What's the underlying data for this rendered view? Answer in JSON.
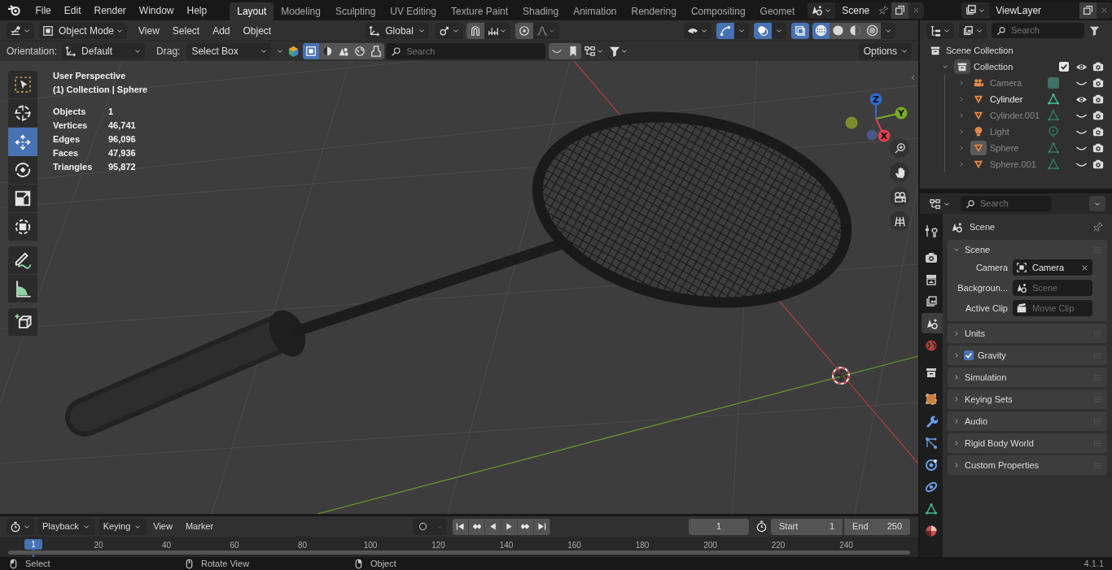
{
  "top_bar": {
    "menus": [
      "File",
      "Edit",
      "Render",
      "Window",
      "Help"
    ],
    "workspaces": [
      {
        "label": "Layout",
        "selected": true
      },
      {
        "label": "Modeling",
        "selected": false
      },
      {
        "label": "Sculpting",
        "selected": false
      },
      {
        "label": "UV Editing",
        "selected": false
      },
      {
        "label": "Texture Paint",
        "selected": false
      },
      {
        "label": "Shading",
        "selected": false
      },
      {
        "label": "Animation",
        "selected": false
      },
      {
        "label": "Rendering",
        "selected": false
      },
      {
        "label": "Compositing",
        "selected": false
      },
      {
        "label": "Geomet",
        "selected": false
      }
    ],
    "scene": "Scene",
    "view_layer": "ViewLayer"
  },
  "viewport_header": {
    "mode": "Object Mode",
    "menus": [
      "View",
      "Select",
      "Add",
      "Object"
    ],
    "transform_orientation": "Global",
    "shading": [
      {
        "kind": "wireframe",
        "selected": true
      },
      {
        "kind": "solid",
        "selected": false
      },
      {
        "kind": "material",
        "selected": false
      },
      {
        "kind": "rendered",
        "selected": false
      }
    ]
  },
  "tool_settings": {
    "orientation_label": "Orientation:",
    "orientation": "Default",
    "drag_label": "Drag:",
    "drag": "Select Box",
    "search_placeholder": "Search",
    "options": "Options"
  },
  "toolbar": [
    [
      {
        "kind": "select",
        "selected": false
      },
      {
        "kind": "cursor",
        "selected": false
      },
      {
        "kind": "move",
        "selected": true
      },
      {
        "kind": "rotate",
        "selected": false
      },
      {
        "kind": "scale",
        "selected": false
      },
      {
        "kind": "transform",
        "selected": false
      }
    ],
    [
      {
        "kind": "annotate",
        "selected": false
      },
      {
        "kind": "measure",
        "selected": false
      }
    ],
    [
      {
        "kind": "add_cube",
        "selected": false
      }
    ]
  ],
  "overlay": {
    "view": "User Perspective",
    "context": "(1) Collection | Sphere",
    "stats": [
      {
        "label": "Objects",
        "value": "1"
      },
      {
        "label": "Vertices",
        "value": "46,741"
      },
      {
        "label": "Edges",
        "value": "96,096"
      },
      {
        "label": "Faces",
        "value": "47,936"
      },
      {
        "label": "Triangles",
        "value": "95,872"
      }
    ]
  },
  "gizmo": {
    "axes": [
      {
        "kind": "z",
        "label": "Z",
        "color": "#2f6bd1"
      },
      {
        "kind": "y",
        "label": "Y",
        "color": "#7bab26"
      },
      {
        "kind": "x",
        "label": "X",
        "color": "#e0404f"
      }
    ]
  },
  "outliner": {
    "search_placeholder": "Search",
    "root": "Scene Collection",
    "collections": [
      {
        "name": "Collection",
        "expanded": true,
        "checked": true,
        "visible": true,
        "children": [
          {
            "name": "Camera",
            "kind": "camera",
            "visible": false,
            "selected": false
          },
          {
            "name": "Cylinder",
            "kind": "mesh",
            "visible": true,
            "selected": false
          },
          {
            "name": "Cylinder.001",
            "kind": "mesh",
            "visible": false,
            "selected": false
          },
          {
            "name": "Light",
            "kind": "light",
            "visible": false,
            "selected": false
          },
          {
            "name": "Sphere",
            "kind": "mesh",
            "visible": false,
            "selected": true
          },
          {
            "name": "Sphere.001",
            "kind": "mesh",
            "visible": false,
            "selected": false
          }
        ]
      }
    ]
  },
  "properties": {
    "search_placeholder": "Search",
    "context": "Scene",
    "tabs": [
      {
        "kind": "tool",
        "selected": false
      },
      {
        "kind": "render",
        "selected": false
      },
      {
        "kind": "output",
        "selected": false
      },
      {
        "kind": "view_layer",
        "selected": false
      },
      {
        "kind": "scene",
        "selected": true
      },
      {
        "kind": "world",
        "selected": false
      },
      {
        "kind": "collection",
        "selected": false
      },
      {
        "kind": "object",
        "selected": false
      },
      {
        "kind": "modifiers",
        "selected": false
      },
      {
        "kind": "particles",
        "selected": false
      },
      {
        "kind": "physics",
        "selected": false
      },
      {
        "kind": "constraints",
        "selected": false
      },
      {
        "kind": "data",
        "selected": false
      },
      {
        "kind": "material",
        "selected": false
      }
    ],
    "panels": [
      {
        "title": "Scene",
        "expanded": true,
        "fields": [
          {
            "label": "Camera",
            "kind": "camera",
            "value": "Camera"
          },
          {
            "label": "Backgroun...",
            "kind": "scene",
            "placeholder": "Scene"
          },
          {
            "label": "Active Clip",
            "kind": "clip",
            "placeholder": "Movie Clip"
          }
        ]
      },
      {
        "title": "Units",
        "expanded": false
      },
      {
        "title": "Gravity",
        "expanded": false,
        "checked": true
      },
      {
        "title": "Simulation",
        "expanded": false
      },
      {
        "title": "Keying Sets",
        "expanded": false
      },
      {
        "title": "Audio",
        "expanded": false
      },
      {
        "title": "Rigid Body World",
        "expanded": false
      },
      {
        "title": "Custom Properties",
        "expanded": false
      }
    ]
  },
  "timeline": {
    "menus": [
      "Playback",
      "Keying",
      "View",
      "Marker"
    ],
    "current_frame": "1",
    "start_label": "Start",
    "start": "1",
    "end_label": "End",
    "end": "250",
    "frame_marker": "1",
    "ruler": [
      "20",
      "40",
      "60",
      "80",
      "100",
      "120",
      "140",
      "160",
      "180",
      "200",
      "220",
      "240"
    ]
  },
  "status_bar": {
    "hints": [
      {
        "kind": "left_click",
        "label": "Select"
      },
      {
        "kind": "middle_click",
        "label": "Rotate View"
      },
      {
        "kind": "right_click",
        "label": "Object"
      }
    ],
    "version": "4.1.1"
  }
}
